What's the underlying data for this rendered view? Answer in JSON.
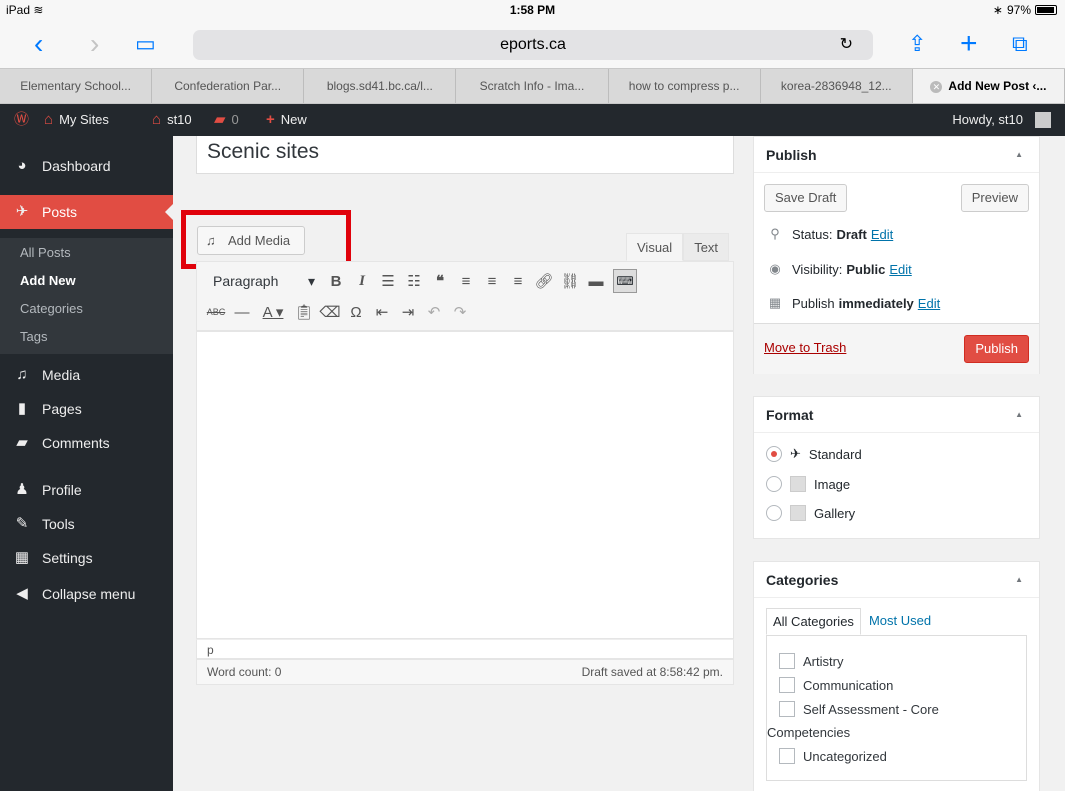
{
  "status_bar": {
    "device": "iPad",
    "wifi_icon": "wifi-icon",
    "time": "1:58 PM",
    "battery": "97%",
    "battery_level": 0.97
  },
  "browser": {
    "url": "eports.ca",
    "tabs": [
      {
        "label": "Elementary School..."
      },
      {
        "label": "Confederation Par..."
      },
      {
        "label": "blogs.sd41.bc.ca/l..."
      },
      {
        "label": "Scratch Info - Ima..."
      },
      {
        "label": "how to compress p..."
      },
      {
        "label": "korea-2836948_12..."
      },
      {
        "label": "Add New Post ‹..."
      }
    ]
  },
  "admin_bar": {
    "my_sites": "My Sites",
    "site": "st10",
    "comments_count": "0",
    "new": "New",
    "howdy": "Howdy, st10"
  },
  "sidebar": {
    "dashboard": "Dashboard",
    "posts": "Posts",
    "posts_sub": {
      "all": "All Posts",
      "add_new": "Add New",
      "categories": "Categories",
      "tags": "Tags"
    },
    "media": "Media",
    "pages": "Pages",
    "comments": "Comments",
    "profile": "Profile",
    "tools": "Tools",
    "settings": "Settings",
    "collapse": "Collapse menu"
  },
  "editor": {
    "title_value": "Scenic sites",
    "add_media": "Add Media",
    "tab_visual": "Visual",
    "tab_text": "Text",
    "format_select": "Paragraph",
    "path": "p",
    "word_count": "Word count: 0",
    "draft_saved": "Draft saved at 8:58:42 pm."
  },
  "publish": {
    "heading": "Publish",
    "save_draft": "Save Draft",
    "preview": "Preview",
    "status_label": "Status:",
    "status_value": "Draft",
    "visibility_label": "Visibility:",
    "visibility_value": "Public",
    "publish_label": "Publish",
    "publish_value": "immediately",
    "edit": "Edit",
    "move_to_trash": "Move to Trash",
    "publish_button": "Publish"
  },
  "format": {
    "heading": "Format",
    "options": [
      {
        "label": "Standard",
        "selected": true
      },
      {
        "label": "Image",
        "selected": false
      },
      {
        "label": "Gallery",
        "selected": false
      }
    ]
  },
  "categories": {
    "heading": "Categories",
    "tab_all": "All Categories",
    "tab_most_used": "Most Used",
    "items": [
      {
        "label": "Artistry"
      },
      {
        "label": "Communication"
      },
      {
        "label": "Self Assessment - Core"
      },
      {
        "label": "Uncategorized"
      }
    ],
    "wrapped_text": "Competencies"
  },
  "colors": {
    "accent": "#e14d43",
    "admin_dark": "#23282d",
    "link": "#0073aa",
    "highlight": "#e0010b"
  }
}
